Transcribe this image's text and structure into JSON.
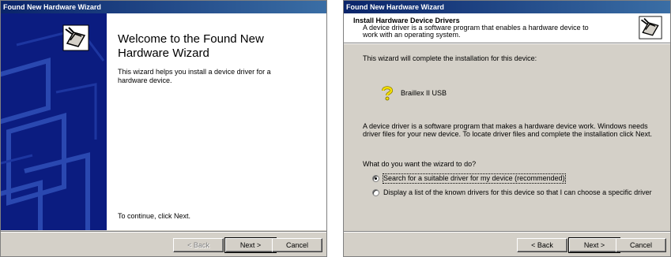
{
  "window1": {
    "title": "Found New Hardware Wizard",
    "welcome_title": "Welcome to the Found New Hardware Wizard",
    "description": "This wizard helps you install a device driver for a hardware device.",
    "continue_text": "To continue, click Next.",
    "buttons": {
      "back": "< Back",
      "next": "Next >",
      "cancel": "Cancel"
    }
  },
  "window2": {
    "title": "Found New Hardware Wizard",
    "header_title": "Install Hardware Device Drivers",
    "header_desc": "A device driver is a software program that enables a hardware device to work with an operating system.",
    "intro": "This wizard will complete the installation for this device:",
    "device_name": "Braillex II USB",
    "paragraph": "A device driver is a software program that makes a hardware device work. Windows needs driver files for your new device. To locate driver files and complete the installation click Next.",
    "question": "What do you want the wizard to do?",
    "options": [
      {
        "label": "Search for a suitable driver for my device (recommended)",
        "selected": true
      },
      {
        "label": "Display a list of the known drivers for this device so that I can choose a specific driver",
        "selected": false
      }
    ],
    "buttons": {
      "back": "< Back",
      "next": "Next >",
      "cancel": "Cancel"
    }
  }
}
